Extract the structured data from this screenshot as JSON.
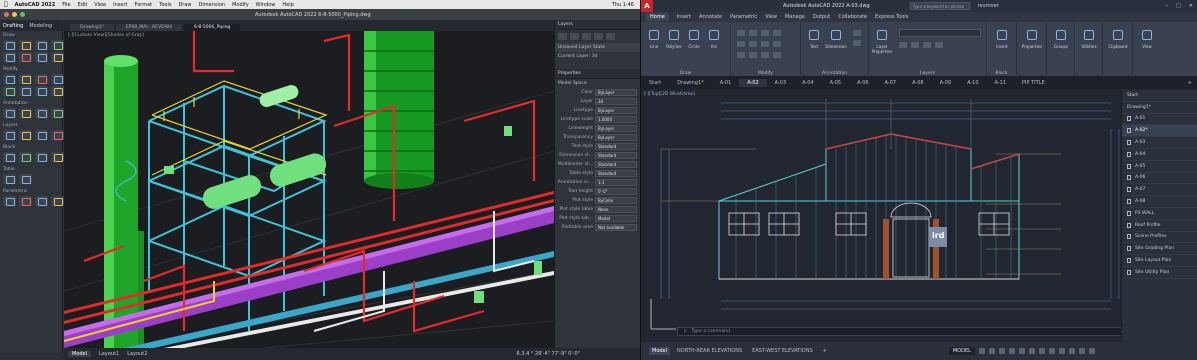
{
  "mac": {
    "menu": [
      "AutoCAD 2022",
      "File",
      "Edit",
      "View",
      "Insert",
      "Format",
      "Tools",
      "Draw",
      "Dimension",
      "Modify",
      "Window",
      "Help"
    ],
    "clock": "Thu 1:46",
    "window_title": "Autodesk AutoCAD 2022   6-8-5000_Piping.dwg",
    "panel_tabs": [
      "Drafting",
      "Modeling"
    ],
    "tool_sections": [
      "Draw",
      "Modify",
      "Annotation",
      "Layers",
      "Block",
      "Table",
      "Parametric"
    ],
    "doc_tabs": [
      "Drawing1*",
      "EPS8_MAI...ACVDW4",
      "6-8-5000_Piping"
    ],
    "viewport_label": "[-][Custom View][Shades of Gray]",
    "layouts": [
      "Model",
      "Layout1",
      "Layout2"
    ],
    "status_right": "6.3.4 °  28'-4\"  77'-9\"  0'-0\"",
    "layers_title": "Layers",
    "layer_state": "Unsaved Layer State",
    "layer_current": "Current Layer: 3d",
    "properties_title": "Properties",
    "properties_scope": "Model Space",
    "properties": [
      {
        "k": "Color",
        "v": "ByLayer"
      },
      {
        "k": "Layer",
        "v": "3d"
      },
      {
        "k": "Linetype",
        "v": "ByLayer"
      },
      {
        "k": "Linetype scale",
        "v": "1.0000"
      },
      {
        "k": "Lineweight",
        "v": "ByLayer"
      },
      {
        "k": "Transparency",
        "v": "ByLayer"
      },
      {
        "k": "Text style",
        "v": "Standard"
      },
      {
        "k": "Dimension st...",
        "v": "Standard"
      },
      {
        "k": "Multileader st...",
        "v": "Standard"
      },
      {
        "k": "Table style",
        "v": "Standard"
      },
      {
        "k": "Annotation sc...",
        "v": "1:1"
      },
      {
        "k": "Text height",
        "v": "0'-0\""
      },
      {
        "k": "Plot style",
        "v": "ByColor"
      },
      {
        "k": "Plot style table",
        "v": "None"
      },
      {
        "k": "Plot style tab...",
        "v": "Model"
      },
      {
        "k": "Plottable area",
        "v": "Not available"
      }
    ]
  },
  "win": {
    "logo": "A",
    "app_title": "Autodesk AutoCAD 2022   A-03.dwg",
    "search_placeholder": "Type a keyword or phrase",
    "user": "rsumner",
    "ribbon_tabs": [
      "Home",
      "Insert",
      "Annotate",
      "Parametric",
      "View",
      "Manage",
      "Output",
      "Collaborate",
      "Express Tools"
    ],
    "groups": [
      "Draw",
      "Modify",
      "Annotation",
      "Layers",
      "Block",
      "Properties",
      "Groups",
      "Utilities",
      "Clipboard",
      "View"
    ],
    "tools": {
      "line": "Line",
      "polyline": "Polyline",
      "circle": "Circle",
      "arc": "Arc",
      "text": "Text",
      "dimension": "Dimension",
      "layer_props": "Layer Properties",
      "insert": "Insert",
      "properties": "Properties",
      "groups": "Groups",
      "utilities": "Utilities",
      "clipboard": "Clipboard",
      "view": "View"
    },
    "file_tabs": [
      "Start",
      "Drawing1*",
      "A-01",
      "A-02",
      "A-03",
      "A-04",
      "A-05",
      "A-06",
      "A-07",
      "A-08",
      "A-09",
      "A-10",
      "A-11",
      "PIP TITLE"
    ],
    "active_file": "A-02",
    "viewport_label": "[-][Top][2D Wireframe]",
    "command_placeholder": "Type a command",
    "layouts": [
      "Model",
      "NORTH-REAR ELEVATIONS",
      "EAST-WEST ELEVATIONS"
    ],
    "model_btn": "MODEL",
    "sheets": [
      "Start",
      "Drawing1*",
      "A-01",
      "A-02*",
      "A-03",
      "A-04",
      "A-05",
      "A-06",
      "A-07",
      "A-08",
      "P3 WALL",
      "Roof Profile",
      "Scene Profiles",
      "Site Grading Plan",
      "Site Layout Plan",
      "Site Utility Plan"
    ],
    "selected_sheet": "A-02*",
    "stamp": "ird"
  }
}
